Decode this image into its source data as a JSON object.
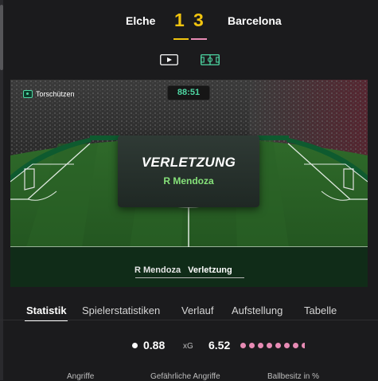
{
  "match": {
    "home_team": "Elche",
    "away_team": "Barcelona",
    "home_score": "1",
    "away_score": "3",
    "colors": {
      "home": "#f1c40f",
      "away": "#e78bb4",
      "accent": "#4ed7a3",
      "player": "#86e27a"
    }
  },
  "view_toggles": [
    {
      "icon": "video-play-icon"
    },
    {
      "icon": "pitch-view-icon"
    }
  ],
  "pitch": {
    "scorers_label": "Torschützen",
    "clock": "88:51",
    "event": {
      "type": "VERLETZUNG",
      "player": "R Mendoza"
    },
    "ticker": {
      "player": "R Mendoza",
      "event": "Verletzung"
    }
  },
  "tabs": [
    {
      "label": "Statistik",
      "active": true
    },
    {
      "label": "Spielerstatistiken",
      "active": false
    },
    {
      "label": "Verlauf",
      "active": false
    },
    {
      "label": "Aufstellung",
      "active": false
    },
    {
      "label": "Tabelle",
      "active": false
    }
  ],
  "xg": {
    "label": "xG",
    "home_value": "0.88",
    "away_value": "6.52"
  },
  "stat_headers": [
    "Angriffe",
    "Gefährliche Angriffe",
    "Ballbesitz in %"
  ]
}
